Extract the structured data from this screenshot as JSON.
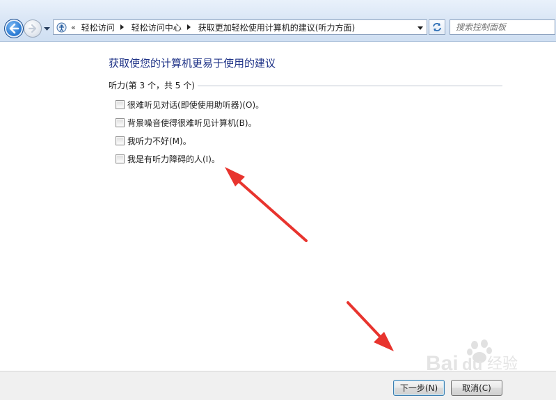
{
  "navigation": {
    "breadcrumb_overflow": "«",
    "breadcrumbs": [
      "轻松访问",
      "轻松访问中心",
      "获取更加轻松使用计算机的建议(听力方面)"
    ],
    "search_placeholder": "搜索控制面板"
  },
  "content": {
    "title": "获取使您的计算机更易于使用的建议",
    "group_label": "听力(第 3 个，共 5 个)",
    "options": [
      {
        "label": "很难听见对话(即使使用助听器)(O)。",
        "checked": false
      },
      {
        "label": "背景噪音使得很难听见计算机(B)。",
        "checked": false
      },
      {
        "label": "我听力不好(M)。",
        "checked": false
      },
      {
        "label": "我是有听力障碍的人(I)。",
        "checked": false
      }
    ]
  },
  "buttons": {
    "next": "下一步(N)",
    "cancel": "取消(C)"
  },
  "watermark": {
    "brand": "Bai",
    "brand2": "du",
    "suffix": "经验"
  },
  "colors": {
    "title": "#1e3287",
    "annotation_arrow": "#e8342e",
    "nav_back": "#2f7fd6"
  },
  "icons": {
    "back": "arrow-left-icon",
    "forward": "arrow-right-icon",
    "address": "control-panel-icon",
    "refresh": "refresh-icon",
    "dropdown": "chevron-down-icon"
  }
}
